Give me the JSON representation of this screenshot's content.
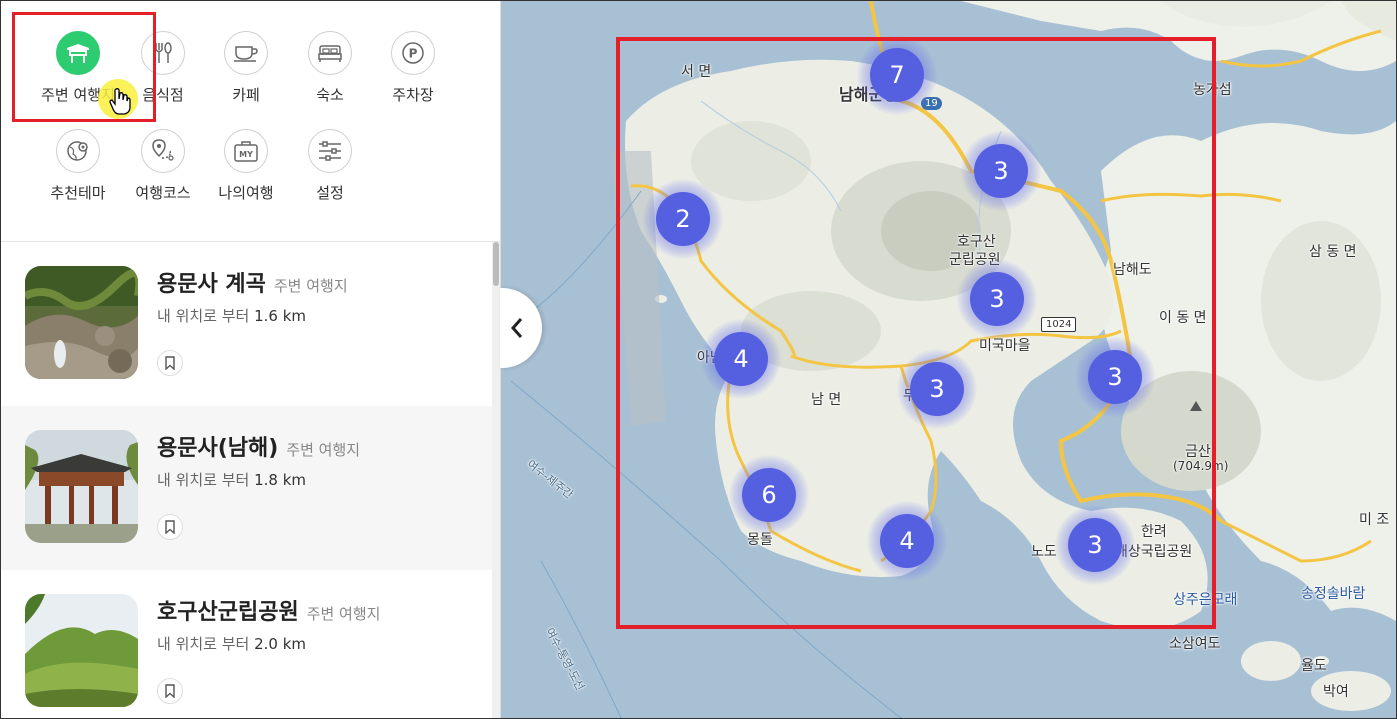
{
  "categories": [
    {
      "label": "주변 여행지",
      "icon": "table-tent-icon",
      "active": true
    },
    {
      "label": "음식점",
      "icon": "fork-spoon-icon",
      "active": false
    },
    {
      "label": "카페",
      "icon": "coffee-cup-icon",
      "active": false
    },
    {
      "label": "숙소",
      "icon": "bed-icon",
      "active": false
    },
    {
      "label": "주차장",
      "icon": "parking-icon",
      "active": false
    },
    {
      "label": "추천테마",
      "icon": "theme-globe-icon",
      "active": false
    },
    {
      "label": "여행코스",
      "icon": "route-pin-icon",
      "active": false
    },
    {
      "label": "나의여행",
      "icon": "my-bag-icon",
      "active": false
    },
    {
      "label": "설정",
      "icon": "sliders-icon",
      "active": false
    }
  ],
  "my_badge": "MY",
  "parking_badge": "P",
  "places": [
    {
      "title": "용문사 계곡",
      "tag": "주변 여행지",
      "dist_prefix": "내 위치로 부터",
      "dist_value": "1.6 km"
    },
    {
      "title": "용문사(남해)",
      "tag": "주변 여행지",
      "dist_prefix": "내 위치로 부터",
      "dist_value": "1.8 km"
    },
    {
      "title": "호구산군립공원",
      "tag": "주변 여행지",
      "dist_prefix": "내 위치로 부터",
      "dist_value": "2.0 km"
    }
  ],
  "clusters": [
    {
      "count": "7"
    },
    {
      "count": "3"
    },
    {
      "count": "2"
    },
    {
      "count": "3"
    },
    {
      "count": "4"
    },
    {
      "count": "3"
    },
    {
      "count": "3"
    },
    {
      "count": "6"
    },
    {
      "count": "4"
    },
    {
      "count": "3"
    }
  ],
  "map_labels": {
    "seomyeon": "서 면",
    "namhae_gunchung": "남해군청",
    "road19": "19",
    "road1024": "1024",
    "hogusan1": "호구산",
    "hogusan2": "군립공원",
    "namhaedo": "남해도",
    "idongmyeon": "이 동 면",
    "samdongmyeon": "삼 동 면",
    "nongaseom": "농가섬",
    "migukmaeul": "미국마을",
    "namyeon": "남 면",
    "anbit": "아난",
    "dumo": "두모",
    "geumsan": "금산",
    "geumsan_h": "(704.9m)",
    "mongdol": "몽돌",
    "hallyeo1": "한려",
    "hallyeo2": "해상국립공원",
    "nodo": "노도",
    "sangju": "상주은모래",
    "songjeong": "송정솔바람",
    "sosando": "소삼여도",
    "yuldo": "율도",
    "bakyeo": "박여",
    "mijo": "미 조",
    "ferry1": "여수-제주간",
    "ferry2": "여수-통영-도선"
  }
}
